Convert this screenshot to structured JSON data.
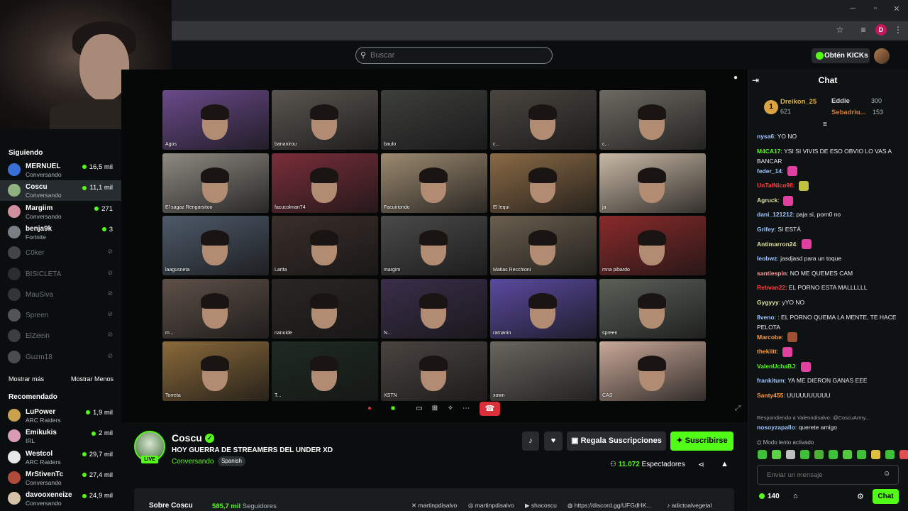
{
  "search": {
    "placeholder": "Buscar"
  },
  "header": {
    "kicks_button": "Obtén KICKs"
  },
  "browser": {
    "profile_letter": "D"
  },
  "sidebar": {
    "following_title": "Siguiendo",
    "following": [
      {
        "name": "MERNUEL",
        "sub": "Conversando",
        "viewers": "16,5 mil",
        "live": true,
        "color": "#3a6fd8"
      },
      {
        "name": "Coscu",
        "sub": "Conversando",
        "viewers": "11,1 mil",
        "live": true,
        "color": "#8fb07f"
      },
      {
        "name": "Margiim",
        "sub": "Conversando",
        "viewers": "271",
        "live": true,
        "color": "#d28fa0"
      },
      {
        "name": "benja9k",
        "sub": "Fortnite",
        "viewers": "3",
        "live": true,
        "color": "#7a7f85"
      },
      {
        "name": "C0ker",
        "live": false,
        "color": "#888"
      },
      {
        "name": "BISICLETA",
        "live": false,
        "color": "#555"
      },
      {
        "name": "MauSiva",
        "live": false,
        "color": "#666"
      },
      {
        "name": "Spreen",
        "live": false,
        "color": "#aaa"
      },
      {
        "name": "ElZeein",
        "live": false,
        "color": "#777"
      },
      {
        "name": "Guzm18",
        "live": false,
        "color": "#999"
      }
    ],
    "show_more": "Mostrar más",
    "show_less": "Mostrar Menos",
    "recommended_title": "Recomendado",
    "recommended": [
      {
        "name": "LuPower",
        "sub": "ARC Raiders",
        "viewers": "1,9 mil",
        "color": "#c9a24b"
      },
      {
        "name": "Emikukis",
        "sub": "IRL",
        "viewers": "2 mil",
        "color": "#d99ab4"
      },
      {
        "name": "Westcol",
        "sub": "ARC Raiders",
        "viewers": "29,7 mil",
        "color": "#e8e8e8"
      },
      {
        "name": "MrStivenTc",
        "sub": "Conversando",
        "viewers": "27,4 mil",
        "color": "#b04a3a"
      },
      {
        "name": "davooxeneize",
        "sub": "Conversando",
        "viewers": "24,9 mil",
        "color": "#d6c2a8"
      }
    ]
  },
  "call": {
    "tiles": [
      {
        "label": "Agos",
        "bg": "#6a4a8a",
        "face": true
      },
      {
        "label": "bananirou",
        "bg": "#5a5550",
        "face": true
      },
      {
        "label": "baulo",
        "bg": "#3d3f3c",
        "face": false
      },
      {
        "label": "c...",
        "bg": "#4a4540",
        "face": true
      },
      {
        "label": "c...",
        "bg": "#6d6a62",
        "face": true
      },
      {
        "label": "El sagaz Rengarsitoo",
        "bg": "#8e8a82",
        "face": true
      },
      {
        "label": "facucolman74",
        "bg": "#7a2e3a",
        "face": true
      },
      {
        "label": "Facuiriondo",
        "bg": "#9c8a70",
        "face": true
      },
      {
        "label": "El lequi",
        "bg": "#8a6a45",
        "face": true
      },
      {
        "label": "ja",
        "bg": "#c9b9a5",
        "face": true
      },
      {
        "label": "laagusneta",
        "bg": "#4e5a6a",
        "face": true
      },
      {
        "label": "Larita",
        "bg": "#3a2e2a",
        "face": true
      },
      {
        "label": "margim",
        "bg": "#4a4a4a",
        "face": true
      },
      {
        "label": "Matias Recchioni",
        "bg": "#6a5e4e",
        "face": true
      },
      {
        "label": "mna pibardo",
        "bg": "#8a2a2a",
        "face": true
      },
      {
        "label": "m...",
        "bg": "#5e5048",
        "face": true
      },
      {
        "label": "nanoide",
        "bg": "#2a2624",
        "face": true
      },
      {
        "label": "N...",
        "bg": "#3a2e4a",
        "face": true
      },
      {
        "label": "ramanin",
        "bg": "#5a4aa0",
        "face": true
      },
      {
        "label": "spreen",
        "bg": "#5a6058",
        "face": true
      },
      {
        "label": "Torreta",
        "bg": "#8a6a3a",
        "face": true
      },
      {
        "label": "T...",
        "bg": "#1e2a22",
        "face": true
      },
      {
        "label": "XSTN",
        "bg": "#4a4440",
        "face": true
      },
      {
        "label": "xown",
        "bg": "#6a6660",
        "face": false
      },
      {
        "label": "CAS",
        "bg": "#c9a898",
        "face": true
      }
    ]
  },
  "stream": {
    "live_badge": "LIVE",
    "streamer": "Coscu",
    "title": "HOY GUERRA DE STREAMERS DEL UNDER XD",
    "category": "Conversando",
    "language": "Spanish",
    "gift_button": "Regala Suscripciones",
    "subscribe_button": "Suscribirse",
    "viewers": "11.072",
    "viewers_label": "Espectadores",
    "about_title": "Sobre Coscu",
    "followers": "585,7 mil",
    "followers_label": "Seguidores",
    "socials": [
      "martinpdisalvo",
      "martinpdisalvo",
      "shacoscu",
      "https://discord.gg/UFGdHK...",
      "adictoalvegetal"
    ]
  },
  "chat": {
    "title": "Chat",
    "leaderboard": [
      {
        "rank": "1",
        "name": "Dreikon_25",
        "value": "621",
        "color": "#e0b040"
      },
      {
        "name": "Eddie",
        "value": "300",
        "color": "#cfd2d6"
      },
      {
        "name": "Sebadriu...",
        "value": "153",
        "color": "#e07a30"
      }
    ],
    "messages": [
      {
        "user": "nysa6",
        "color": "#a0c4ff",
        "text": "YO NO"
      },
      {
        "user": "M4CA17",
        "color": "#53fc18",
        "text": "YSI SI VIVIS DE ESO OBVIO LO VAS A BANCAR"
      },
      {
        "user": "feder_14",
        "color": "#a0c4ff",
        "text": "",
        "emote": "#e040a0"
      },
      {
        "user": "UnTalNico98",
        "color": "#ff4040",
        "text": "",
        "emote": "#c0c040"
      },
      {
        "user": "Agruck",
        "color": "#e0e0a0",
        "text": "",
        "emote": "#e040a0"
      },
      {
        "user": "dani_121212",
        "color": "#a0c4ff",
        "text": "paja si, porn0 no"
      },
      {
        "user": "Grifey",
        "color": "#a0c4ff",
        "text": "SI ESTÁ"
      },
      {
        "user": "Antimarron24",
        "color": "#e0e0a0",
        "text": "",
        "emote": "#e040a0"
      },
      {
        "user": "leobwz",
        "color": "#a0c4ff",
        "text": "jasdjasd para un toque"
      },
      {
        "user": "santiespin",
        "color": "#ff9a9a",
        "text": "NO ME QUEMES CAM"
      },
      {
        "user": "Rebvan22",
        "color": "#ff4040",
        "text": "EL PORNO ESTA MALLLLLL"
      },
      {
        "user": "Gygyyy",
        "color": "#e0e0a0",
        "text": "yYO NO"
      },
      {
        "user": "8veno",
        "color": "#a0c4ff",
        "text": ": EL PORNO QUEMA LA MENTE, TE HACE PELOTA"
      },
      {
        "user": "Marcobe",
        "color": "#ff9a40",
        "text": "",
        "emote": "#a05030"
      },
      {
        "user": "thekiitt",
        "color": "#ff9a40",
        "text": "",
        "emote": "#e040a0"
      },
      {
        "user": "ValenUchaBJ",
        "color": "#53fc18",
        "text": "",
        "emote": "#e040a0"
      },
      {
        "user": "frankitum",
        "color": "#a0c4ff",
        "text": "YA ME DIERON GANAS EEE"
      },
      {
        "user": "Santy455",
        "color": "#ff9a40",
        "text": "UUUUUUUUUU"
      }
    ],
    "reply_note": "Respondiendo a Valenndisalvo: @CoscuArmy...",
    "last_message": {
      "user": "nosoyzapallo",
      "color": "#a0c4ff",
      "text": "querete amigo"
    },
    "slow_mode": "Modo lento activado",
    "input_placeholder": "Enviar un mensaje",
    "points": "140",
    "send_button": "Chat"
  },
  "colors": {
    "accent": "#53fc18",
    "end_call": "#d9303a"
  }
}
